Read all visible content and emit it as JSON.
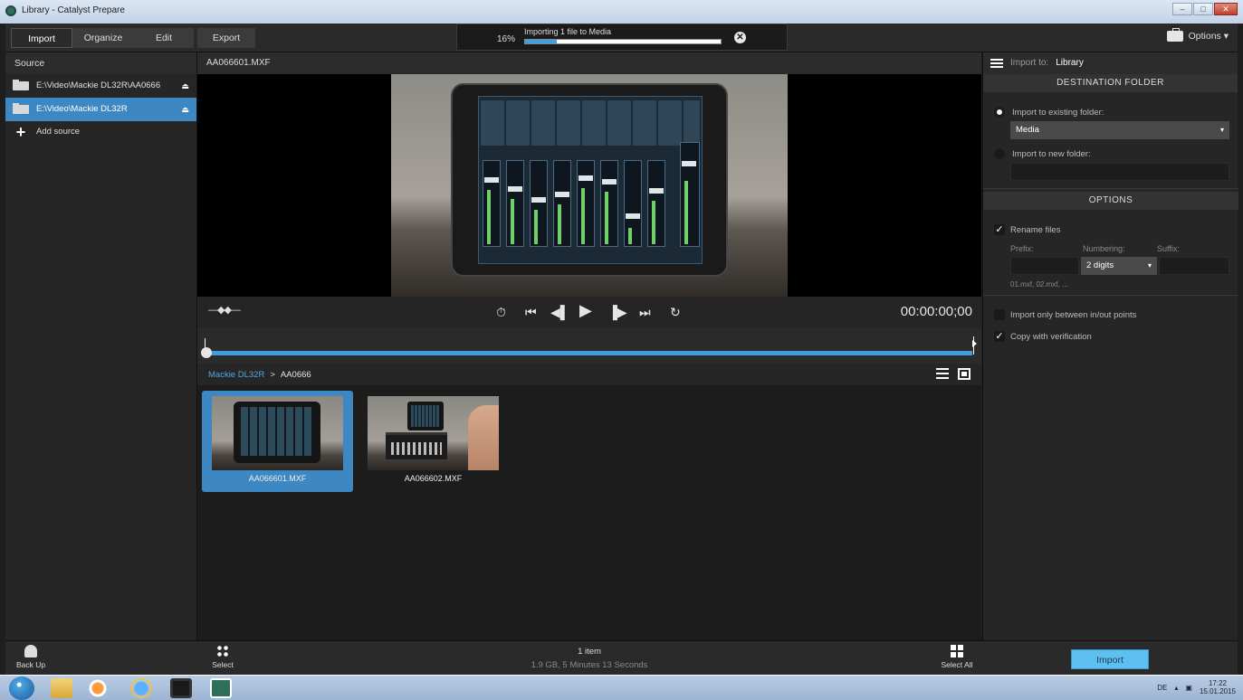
{
  "window": {
    "title": "Library - Catalyst Prepare",
    "minimize": "–",
    "maximize": "□",
    "close": "✕"
  },
  "toolbar": {
    "modes": [
      {
        "label": "Import",
        "active": true
      },
      {
        "label": "Organize",
        "active": false
      },
      {
        "label": "Edit",
        "active": false
      },
      {
        "label": "Export",
        "active": false
      }
    ],
    "progress": {
      "percent_label": "16%",
      "fraction": 0.16,
      "message": "Importing 1 file to Media",
      "cancel": "✕"
    },
    "options_label": "Options ▾"
  },
  "source": {
    "header": "Source",
    "items": [
      {
        "path": "E:\\Video\\Mackie DL32R\\AA0666",
        "selected": false,
        "eject": "⏏"
      },
      {
        "path": "E:\\Video\\Mackie DL32R",
        "selected": true,
        "eject": "⏏"
      }
    ],
    "add_label": "Add source",
    "add_glyph": "+"
  },
  "viewer": {
    "clip_title": "AA066601.MXF",
    "timecode": "00:00:00;00",
    "jog_glyph": "—◆◆—",
    "controls": {
      "loop": "⏱",
      "first": "⏮",
      "prev": "◀▌",
      "play": "▶",
      "next": "▐▶",
      "last": "⏭",
      "repeat": "↻"
    }
  },
  "browser": {
    "breadcrumb_root": "Mackie DL32R",
    "breadcrumb_sep": ">",
    "breadcrumb_leaf": "AA0666",
    "clips": [
      {
        "name": "AA066601.MXF",
        "selected": true
      },
      {
        "name": "AA066602.MXF",
        "selected": false
      }
    ]
  },
  "import_panel": {
    "import_to_label": "Import to:",
    "import_to_value": "Library",
    "destination_header": "DESTINATION FOLDER",
    "existing_folder_label": "Import to existing folder:",
    "existing_folder_value": "Media",
    "new_folder_label": "Import to new folder:",
    "options_header": "OPTIONS",
    "rename_files_label": "Rename files",
    "prefix_label": "Prefix:",
    "numbering_label": "Numbering:",
    "suffix_label": "Suffix:",
    "numbering_value": "2 digits",
    "rename_example": "01.mxf, 02.mxf, ...",
    "inout_label": "Import only between in/out points",
    "verify_label": "Copy with verification",
    "check_glyph": "✓"
  },
  "bottombar": {
    "backup_label": "Back Up",
    "select_label": "Select",
    "select_all_label": "Select All",
    "count": "1 item",
    "size": "1.9 GB, 5 Minutes 13 Seconds",
    "import_button": "Import"
  },
  "taskbar": {
    "lang": "DE",
    "time": "17:22",
    "date": "15.01.2015"
  },
  "colors": {
    "accent": "#3d87c2",
    "progress": "#3da0e0",
    "import_button": "#5ec0f0"
  }
}
